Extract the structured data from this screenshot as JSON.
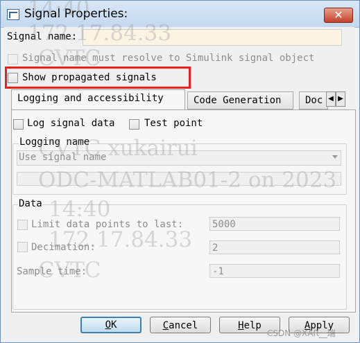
{
  "window": {
    "title": "Signal Properties:",
    "close_label": "✕"
  },
  "signal_name": {
    "label": "Signal name:",
    "value": ""
  },
  "must_resolve": {
    "label": "Signal name must resolve to Simulink signal object",
    "checked": false,
    "enabled": false
  },
  "show_propagated": {
    "label": "Show propagated signals",
    "checked": false
  },
  "tabs": [
    {
      "label": "Logging and accessibility",
      "active": true
    },
    {
      "label": "Code Generation",
      "active": false
    },
    {
      "label": "Doc",
      "active": false
    }
  ],
  "tab_arrows": {
    "left": "◀",
    "right": "▶"
  },
  "logging": {
    "log_signal_label": "Log signal data",
    "test_point_label": "Test point",
    "logging_name_title": "Logging name",
    "logging_name_option": "Use signal name",
    "logging_name_value": ""
  },
  "data": {
    "title": "Data",
    "limit_label": "Limit data points to last:",
    "limit_value": "5000",
    "decimation_label": "Decimation:",
    "decimation_value": "2",
    "sample_time_label": "Sample time:",
    "sample_time_value": "-1"
  },
  "buttons": {
    "ok": "OK",
    "cancel": "Cancel",
    "help": "Help",
    "apply": "Apply"
  },
  "watermark": {
    "line1": "14:40",
    "line2": "172.17.84.33",
    "line3": "CVTC",
    "line4": "CVTC xukairui",
    "line5": "ODC-MATLAB01-2 on 2023",
    "line6": "14:40",
    "line7": "172.17.84.33",
    "line8": "CVTC"
  },
  "csdn_mark": "CSDN @XAR__瑞",
  "colors": {
    "highlight_border": "#ee1c1c",
    "signal_field_bg": "#fcf4e3",
    "close_button": "#c4412c"
  }
}
